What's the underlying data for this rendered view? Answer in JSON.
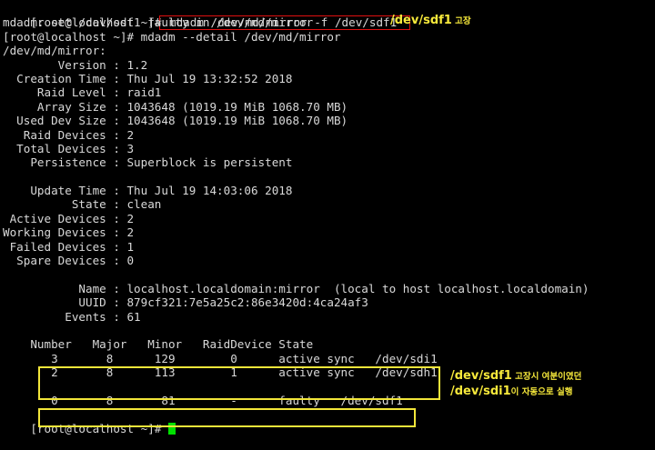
{
  "terminal": {
    "lines": [
      "[root@localhost ~]#",
      "",
      "mdadm: set /dev/sdf1 faulty in /dev/md/mirror",
      "[root@localhost ~]# mdadm --detail /dev/md/mirror",
      "/dev/md/mirror:",
      "        Version : 1.2",
      "  Creation Time : Thu Jul 19 13:32:52 2018",
      "     Raid Level : raid1",
      "     Array Size : 1043648 (1019.19 MiB 1068.70 MB)",
      "  Used Dev Size : 1043648 (1019.19 MiB 1068.70 MB)",
      "   Raid Devices : 2",
      "  Total Devices : 3",
      "    Persistence : Superblock is persistent",
      "",
      "    Update Time : Thu Jul 19 14:03:06 2018",
      "          State : clean",
      " Active Devices : 2",
      "Working Devices : 2",
      " Failed Devices : 1",
      "  Spare Devices : 0",
      "",
      "           Name : localhost.localdomain:mirror  (local to host localhost.localdomain)",
      "           UUID : 879cf321:7e5a25c2:86e3420d:4ca24af3",
      "         Events : 61",
      "",
      "    Number   Major   Minor   RaidDevice State",
      "       3       8      129        0      active sync   /dev/sdi1",
      "       2       8      113        1      active sync   /dev/sdh1",
      "",
      "       0       8       81        -      faulty   /dev/sdf1",
      "[root@localhost ~]# "
    ],
    "first_prompt": "[root@localhost ~]#",
    "highlighted_command": " mdadm /dev/md/mirror -f /dev/sdf1",
    "last_prompt": "[root@localhost ~]# "
  },
  "annotations": {
    "fault_note_main": "/dev/sdf1",
    "fault_note_small": " 고장",
    "note2_line1_main": "/dev/sdf1",
    "note2_line1_small": " 고장시 여분이였던",
    "note2_line2_main": "/dev/sdi1",
    "note2_line2_small": "이 자동으로 실행"
  },
  "colors": {
    "background": "#000000",
    "text": "#d9d9d9",
    "command_box": "#e01010",
    "annotation_yellow": "#f7e93b",
    "cursor": "#00e000"
  }
}
